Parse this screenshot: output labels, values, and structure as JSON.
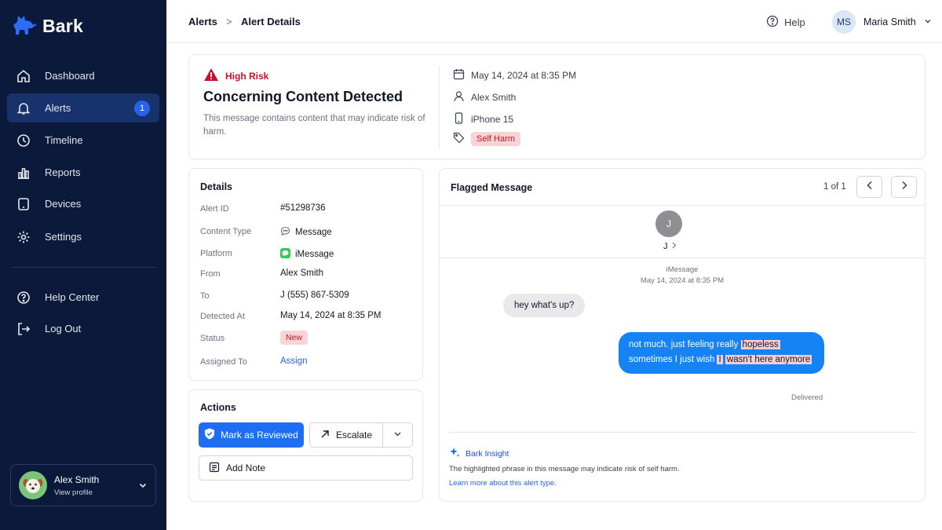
{
  "app": {
    "name": "Bark"
  },
  "sidebar": {
    "items": [
      {
        "label": "Dashboard",
        "icon": "home-icon"
      },
      {
        "label": "Alerts",
        "icon": "bell-icon",
        "badge": "1",
        "active": true
      },
      {
        "label": "Timeline",
        "icon": "clock-icon"
      },
      {
        "label": "Reports",
        "icon": "bar-chart-icon"
      },
      {
        "label": "Devices",
        "icon": "tablet-icon"
      },
      {
        "label": "Settings",
        "icon": "gear-icon"
      }
    ],
    "secondary": [
      {
        "label": "Help Center",
        "icon": "help-circle-icon"
      },
      {
        "label": "Log Out",
        "icon": "logout-icon"
      }
    ],
    "profile": {
      "name": "Alex Smith",
      "sub": "View profile"
    }
  },
  "header": {
    "breadcrumb": [
      "Alerts",
      "Alert Details"
    ],
    "breadcrumb_sep": ">",
    "help": "Help",
    "user_initials": "MS",
    "user_name": "Maria Smith"
  },
  "alert": {
    "risk": "High Risk",
    "title": "Concerning Content Detected",
    "description": "This message contains content that may indicate risk of harm.",
    "datetime": "May 14, 2024 at 8:35 PM",
    "person": "Alex Smith",
    "device": "iPhone 15",
    "tag": "Self Harm"
  },
  "details": {
    "title": "Details",
    "rows": [
      {
        "label": "Alert ID",
        "value": "#51298736"
      },
      {
        "label": "Content Type",
        "value": "Message"
      },
      {
        "label": "Platform",
        "value": "iMessage"
      },
      {
        "label": "From",
        "value": "Alex Smith"
      },
      {
        "label": "To",
        "value": "J (555) 867-5309"
      },
      {
        "label": "Detected At",
        "value": "May 14, 2024 at 8:35 PM"
      },
      {
        "label": "Status",
        "value": "New"
      },
      {
        "label": "Assigned To",
        "value": "Assign"
      }
    ]
  },
  "actions": {
    "title": "Actions",
    "mark_reviewed": "Mark as Reviewed",
    "escalate": "Escalate",
    "add_note": "Add Note"
  },
  "flagged": {
    "title": "Flagged Message",
    "pager": "1 of 1",
    "contact_initial": "J",
    "contact_name": "J",
    "service": "iMessage",
    "timestamp": "May 14, 2024 at 8:35 PM",
    "incoming": "hey what's up?",
    "outgoing": {
      "part1": "not much. just feeling really ",
      "hl1": "hopeless",
      "part2": " sometimes I just wish ",
      "hl2": "I",
      "part3": " ",
      "hl3": "wasn't here anymore"
    },
    "delivered": "Delivered",
    "insight_title": "Bark Insight",
    "insight_text": "The highlighted phrase in this message may indicate risk of self harm.",
    "insight_link": "Learn more about this alert type."
  },
  "colors": {
    "sidebar_bg": "#0b1a3a",
    "accent": "#1d6ef5",
    "risk_red": "#c8102e",
    "bubble_blue": "#1583f4",
    "highlight": "#f8cdd1"
  }
}
